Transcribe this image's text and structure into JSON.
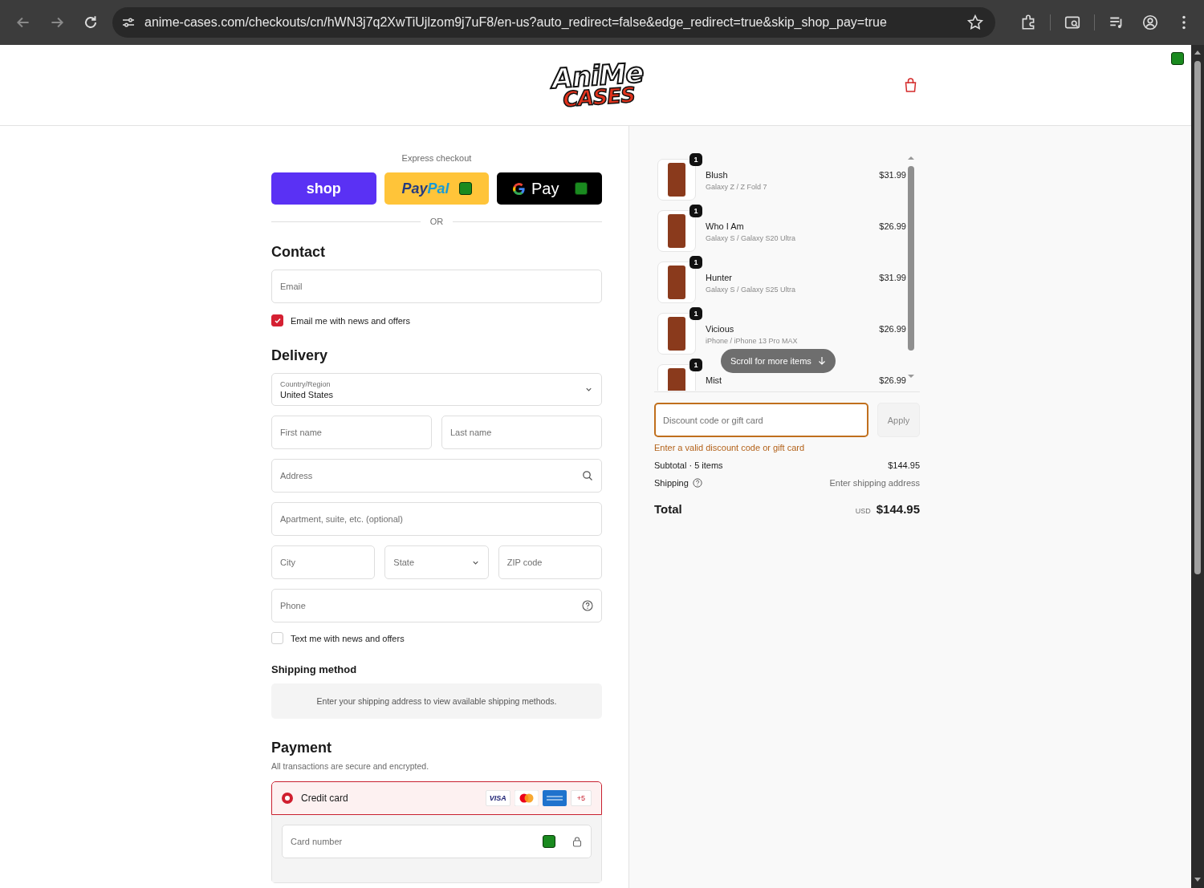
{
  "browser": {
    "url": "anime-cases.com/checkouts/cn/hWN3j7q2XwTiUjlzom9j7uF8/en-us?auto_redirect=false&edge_redirect=true&skip_shop_pay=true"
  },
  "header": {
    "logo": {
      "line1": "AniMe",
      "line2": "CASES"
    }
  },
  "express": {
    "label": "Express checkout",
    "buttons": [
      {
        "kind": "shop",
        "label": "shop"
      },
      {
        "kind": "paypal",
        "label": "Pay",
        "label2": "Pal"
      },
      {
        "kind": "gpay",
        "label": "Pay"
      }
    ],
    "divider": "OR"
  },
  "contact": {
    "heading": "Contact",
    "email": {
      "placeholder": "Email"
    },
    "newsletter": {
      "label": "Email me with news and offers",
      "checked": true
    }
  },
  "delivery": {
    "heading": "Delivery",
    "rows": [
      [
        {
          "kind": "select",
          "label": "Country/Region",
          "value": "United States"
        }
      ],
      [
        {
          "kind": "text",
          "placeholder": "First name"
        },
        {
          "kind": "text",
          "placeholder": "Last name"
        }
      ],
      [
        {
          "kind": "search",
          "placeholder": "Address"
        }
      ],
      [
        {
          "kind": "text",
          "placeholder": "Apartment, suite, etc. (optional)"
        }
      ],
      [
        {
          "kind": "text",
          "placeholder": "City"
        },
        {
          "kind": "select",
          "placeholder": "State"
        },
        {
          "kind": "text",
          "placeholder": "ZIP code"
        }
      ],
      [
        {
          "kind": "help",
          "placeholder": "Phone"
        }
      ]
    ],
    "sms": {
      "label": "Text me with news and offers",
      "checked": false
    }
  },
  "shipping": {
    "heading": "Shipping method",
    "notice": "Enter your shipping address to view available shipping methods."
  },
  "payment": {
    "heading": "Payment",
    "subtitle": "All transactions are secure and encrypted.",
    "methods": [
      {
        "label": "Credit card",
        "selected": true,
        "brands": [
          {
            "kind": "visa",
            "label": "VISA"
          },
          {
            "kind": "mastercard"
          },
          {
            "kind": "amex"
          },
          {
            "kind": "more",
            "label": "+5"
          }
        ]
      }
    ],
    "card_number": {
      "placeholder": "Card number"
    }
  },
  "summary": {
    "items": [
      {
        "name": "Blush",
        "variant": "Galaxy Z / Z Fold 7",
        "price": "$31.99",
        "quantity": "1"
      },
      {
        "name": "Who I Am",
        "variant": "Galaxy S / Galaxy S20 Ultra",
        "price": "$26.99",
        "quantity": "1"
      },
      {
        "name": "Hunter",
        "variant": "Galaxy S / Galaxy S25 Ultra",
        "price": "$31.99",
        "quantity": "1"
      },
      {
        "name": "Vicious",
        "variant": "iPhone / iPhone 13 Pro MAX",
        "price": "$26.99",
        "quantity": "1"
      },
      {
        "name": "Mist",
        "price": "$26.99",
        "quantity": "1"
      }
    ],
    "scroll_hint": "Scroll for more items",
    "discount": {
      "placeholder": "Discount code or gift card",
      "error": "Enter a valid discount code or gift card",
      "apply": "Apply"
    },
    "subtotal_label": "Subtotal · 5 items",
    "subtotal": "$144.95",
    "shipping_label": "Shipping",
    "shipping_value": "Enter shipping address",
    "total_label": "Total",
    "currency": "USD",
    "total": "$144.95"
  }
}
